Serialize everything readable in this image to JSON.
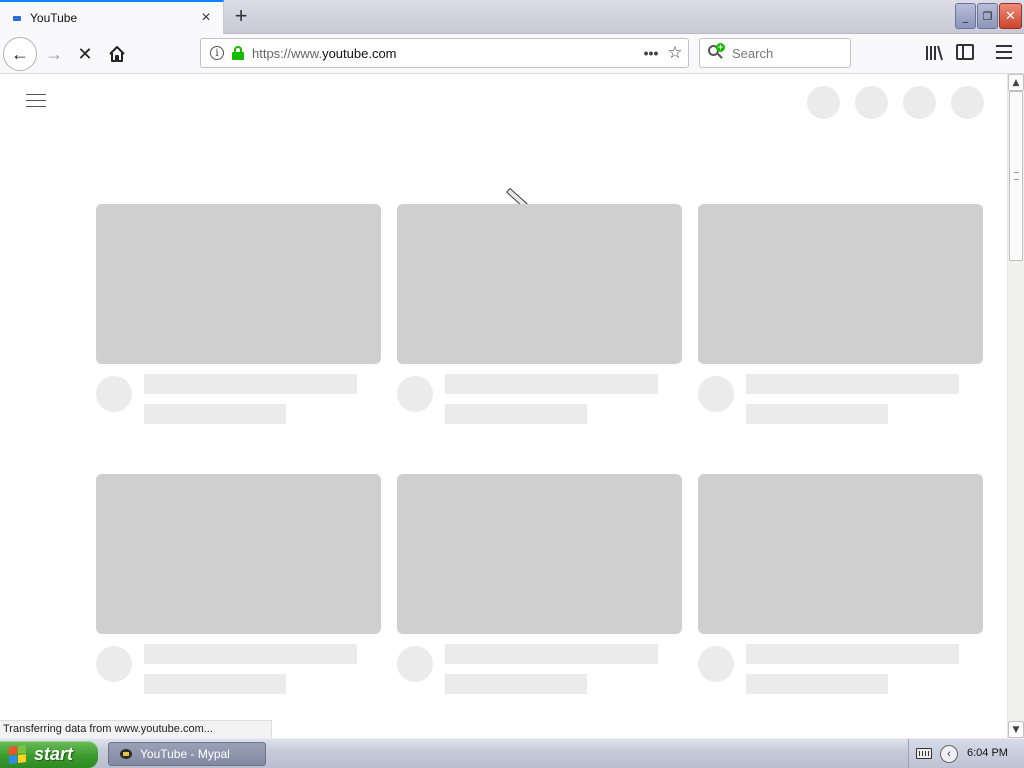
{
  "tab": {
    "title": "YouTube",
    "close": "×"
  },
  "newtab": "+",
  "window": {
    "min": "_",
    "max": "❐",
    "close": "✕"
  },
  "nav": {
    "back": "←",
    "forward": "→",
    "stop": "✕"
  },
  "url": {
    "info": "i",
    "prefix": "https://www.",
    "domain": "youtube.com",
    "more": "•••",
    "star": "☆"
  },
  "search": {
    "placeholder": "Search"
  },
  "page": {
    "status": "Transferring data from www.youtube.com...",
    "cards": [
      {
        "row": 0,
        "col": 0
      },
      {
        "row": 0,
        "col": 1
      },
      {
        "row": 0,
        "col": 2
      },
      {
        "row": 1,
        "col": 0
      },
      {
        "row": 1,
        "col": 1
      },
      {
        "row": 1,
        "col": 2
      }
    ]
  },
  "scrollbar": {
    "up": "▲",
    "down": "▼"
  },
  "taskbar": {
    "start": "start",
    "task": "YouTube - Mypal",
    "tray_arrow": "‹",
    "clock": "6:04 PM"
  },
  "colors": {
    "skeleton_thumb": "#cfcfcf",
    "skeleton_light": "#ebebeb",
    "lock_green": "#12bc00",
    "tab_accent": "#0a84ff",
    "start_green": "#3b9b2c"
  }
}
